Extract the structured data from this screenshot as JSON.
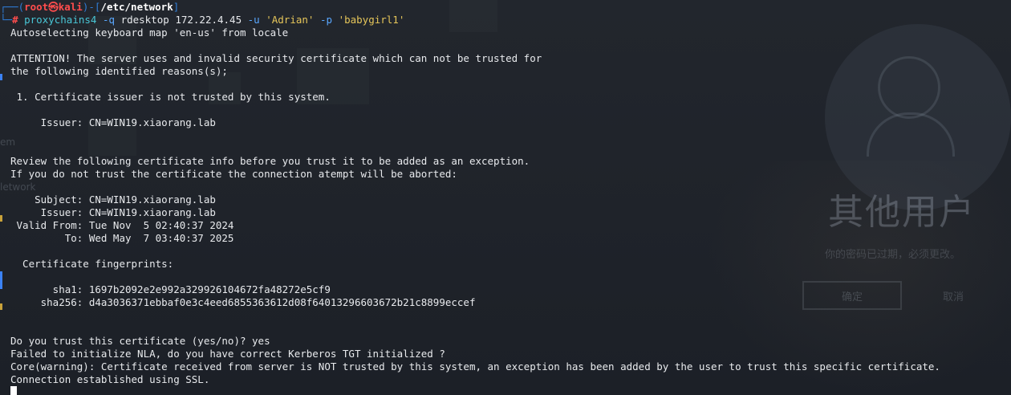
{
  "background": {
    "remote_screen": {
      "title": "其他用户",
      "subtitle": "你的密码已过期，必须更改。",
      "ok_button": "确定",
      "cancel_button": "取消",
      "sidebar_fragments": [
        "em",
        "letwork"
      ]
    }
  },
  "prompt": {
    "user": "root",
    "host": "kali",
    "cwd": "/etc/network",
    "symbol": "#"
  },
  "command": {
    "program": "proxychains4",
    "flag_q": "-q",
    "tool": "rdesktop",
    "target": "172.22.4.45",
    "flag_u": "-u",
    "user_arg": "'Adrian'",
    "flag_p": "-p",
    "pass_arg": "'babygirl1'"
  },
  "output_lines": [
    "Autoselecting keyboard map 'en-us' from locale",
    "",
    "ATTENTION! The server uses and invalid security certificate which can not be trusted for",
    "the following identified reasons(s);",
    "",
    " 1. Certificate issuer is not trusted by this system.",
    "",
    "     Issuer: CN=WIN19.xiaorang.lab",
    "",
    "",
    "Review the following certificate info before you trust it to be added as an exception.",
    "If you do not trust the certificate the connection atempt will be aborted:",
    "",
    "    Subject: CN=WIN19.xiaorang.lab",
    "     Issuer: CN=WIN19.xiaorang.lab",
    " Valid From: Tue Nov  5 02:40:37 2024",
    "         To: Wed May  7 03:40:37 2025",
    "",
    "  Certificate fingerprints:",
    "",
    "       sha1: 1697b2092e2e992a329926104672fa48272e5cf9",
    "     sha256: d4a3036371ebbaf0e3c4eed6855363612d08f64013296603672b21c8899eccef",
    "",
    "",
    "Do you trust this certificate (yes/no)? yes",
    "Failed to initialize NLA, do you have correct Kerberos TGT initialized ?",
    "Core(warning): Certificate received from server is NOT trusted by this system, an exception has been added by the user to trust this specific certificate.",
    "Connection established using SSL."
  ],
  "colors": {
    "prompt_frame": "#2f7dd8",
    "prompt_user": "#ff4d4d",
    "command": "#49c7d6",
    "flag": "#5aa8ff",
    "string_arg": "#e6c65a",
    "text": "#e8eaed"
  }
}
